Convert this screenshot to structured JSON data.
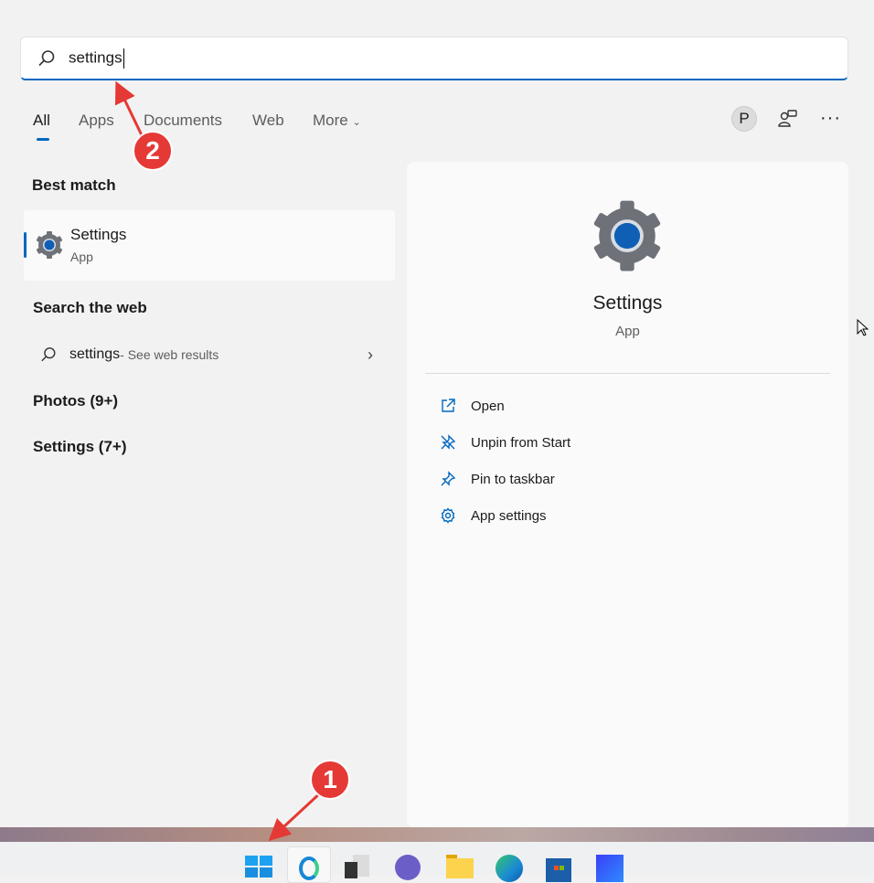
{
  "search": {
    "value": "settings"
  },
  "tabs": [
    {
      "label": "All"
    },
    {
      "label": "Apps"
    },
    {
      "label": "Documents"
    },
    {
      "label": "Web"
    },
    {
      "label": "More"
    }
  ],
  "profile_initial": "P",
  "left": {
    "best_match_heading": "Best match",
    "best_match": {
      "title": "Settings",
      "subtitle": "App"
    },
    "search_web_heading": "Search the web",
    "web_result": {
      "query": "settings",
      "suffix": " - See web results"
    },
    "groups": [
      {
        "label": "Photos (9+)"
      },
      {
        "label": "Settings (7+)"
      }
    ]
  },
  "right": {
    "title": "Settings",
    "subtitle": "App",
    "actions": [
      {
        "label": "Open"
      },
      {
        "label": "Unpin from Start"
      },
      {
        "label": "Pin to taskbar"
      },
      {
        "label": "App settings"
      }
    ]
  },
  "annotations": [
    {
      "number": "1"
    },
    {
      "number": "2"
    }
  ],
  "colors": {
    "accent": "#0067c0",
    "annotation": "#e53935"
  }
}
